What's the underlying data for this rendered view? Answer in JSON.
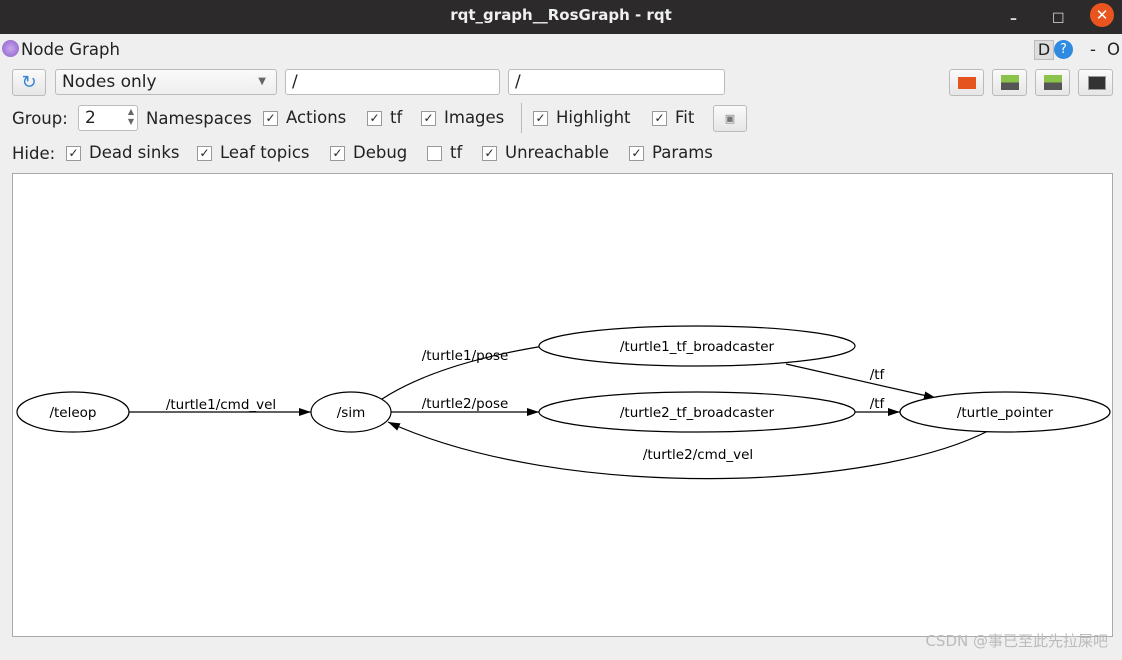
{
  "window": {
    "title": "rqt_graph__RosGraph - rqt",
    "minimize": "–",
    "maximize": "☐",
    "close": "✕"
  },
  "plugin": {
    "title": "Node Graph",
    "d_label": "D",
    "help": "?",
    "dash": "-",
    "o": "O"
  },
  "toolbar": {
    "mode": "Nodes only",
    "filter1": "/",
    "filter2": "/"
  },
  "options": {
    "group_label": "Group:",
    "group_value": "2",
    "items": [
      {
        "label": "Namespaces",
        "checked": null
      },
      {
        "label": "Actions",
        "checked": true
      },
      {
        "label": "tf",
        "checked": true
      },
      {
        "label": "Images",
        "checked": true
      },
      {
        "label": "Highlight",
        "checked": true
      },
      {
        "label": "Fit",
        "checked": true
      }
    ]
  },
  "hide": {
    "label": "Hide:",
    "items": [
      {
        "label": "Dead sinks",
        "checked": true
      },
      {
        "label": "Leaf topics",
        "checked": true
      },
      {
        "label": "Debug",
        "checked": true
      },
      {
        "label": "tf",
        "checked": false
      },
      {
        "label": "Unreachable",
        "checked": true
      },
      {
        "label": "Params",
        "checked": true
      }
    ]
  },
  "graph": {
    "nodes": [
      "/teleop",
      "/sim",
      "/turtle1_tf_broadcaster",
      "/turtle2_tf_broadcaster",
      "/turtle_pointer"
    ],
    "edges": [
      {
        "from": "/teleop",
        "to": "/sim",
        "label": "/turtle1/cmd_vel"
      },
      {
        "from": "/sim",
        "to": "/turtle1_tf_broadcaster",
        "label": "/turtle1/pose"
      },
      {
        "from": "/sim",
        "to": "/turtle2_tf_broadcaster",
        "label": "/turtle2/pose"
      },
      {
        "from": "/turtle1_tf_broadcaster",
        "to": "/turtle_pointer",
        "label": "/tf"
      },
      {
        "from": "/turtle2_tf_broadcaster",
        "to": "/turtle_pointer",
        "label": "/tf"
      },
      {
        "from": "/turtle_pointer",
        "to": "/sim",
        "label": "/turtle2/cmd_vel"
      }
    ]
  },
  "watermark": "CSDN @事已至此先拉屎吧"
}
